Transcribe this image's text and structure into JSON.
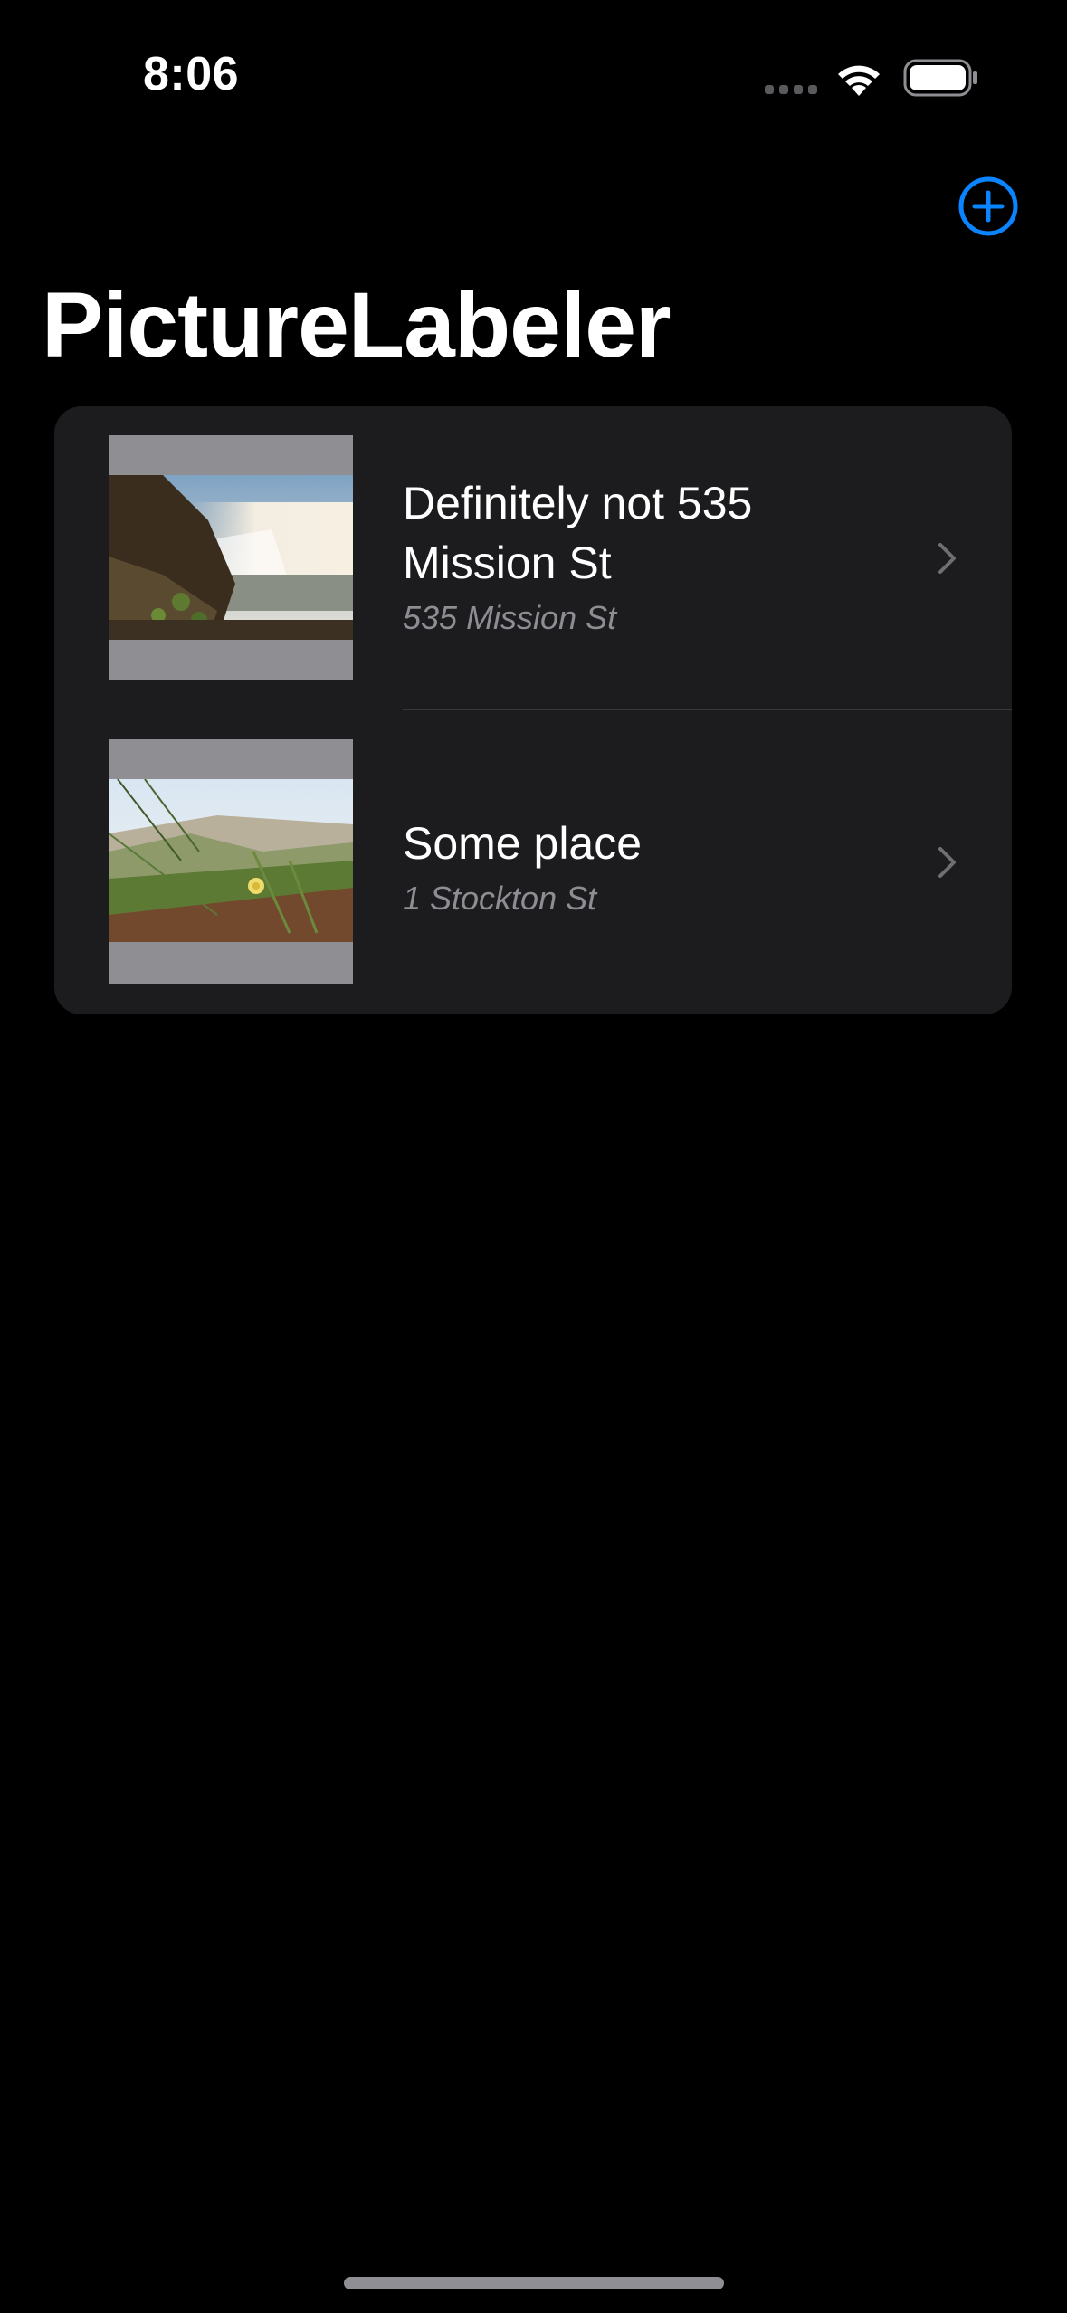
{
  "status_bar": {
    "time": "8:06",
    "icons": [
      "signal-dots-icon",
      "wifi-icon",
      "battery-icon"
    ]
  },
  "nav": {
    "add_button_icon": "plus-circle-icon",
    "title": "PictureLabeler"
  },
  "list": {
    "items": [
      {
        "title": "Definitely not 535 Mission St",
        "subtitle": "535 Mission St",
        "thumbnail": "waterfall-photo"
      },
      {
        "title": "Some place",
        "subtitle": "1 Stockton St",
        "thumbnail": "dune-flower-photo"
      }
    ]
  },
  "colors": {
    "background": "#000000",
    "card": "#1c1c1e",
    "accent": "#0a84ff",
    "secondary_text": "#8d8d93",
    "separator": "#38383a",
    "thumbnail_bg": "#8e8e93"
  }
}
